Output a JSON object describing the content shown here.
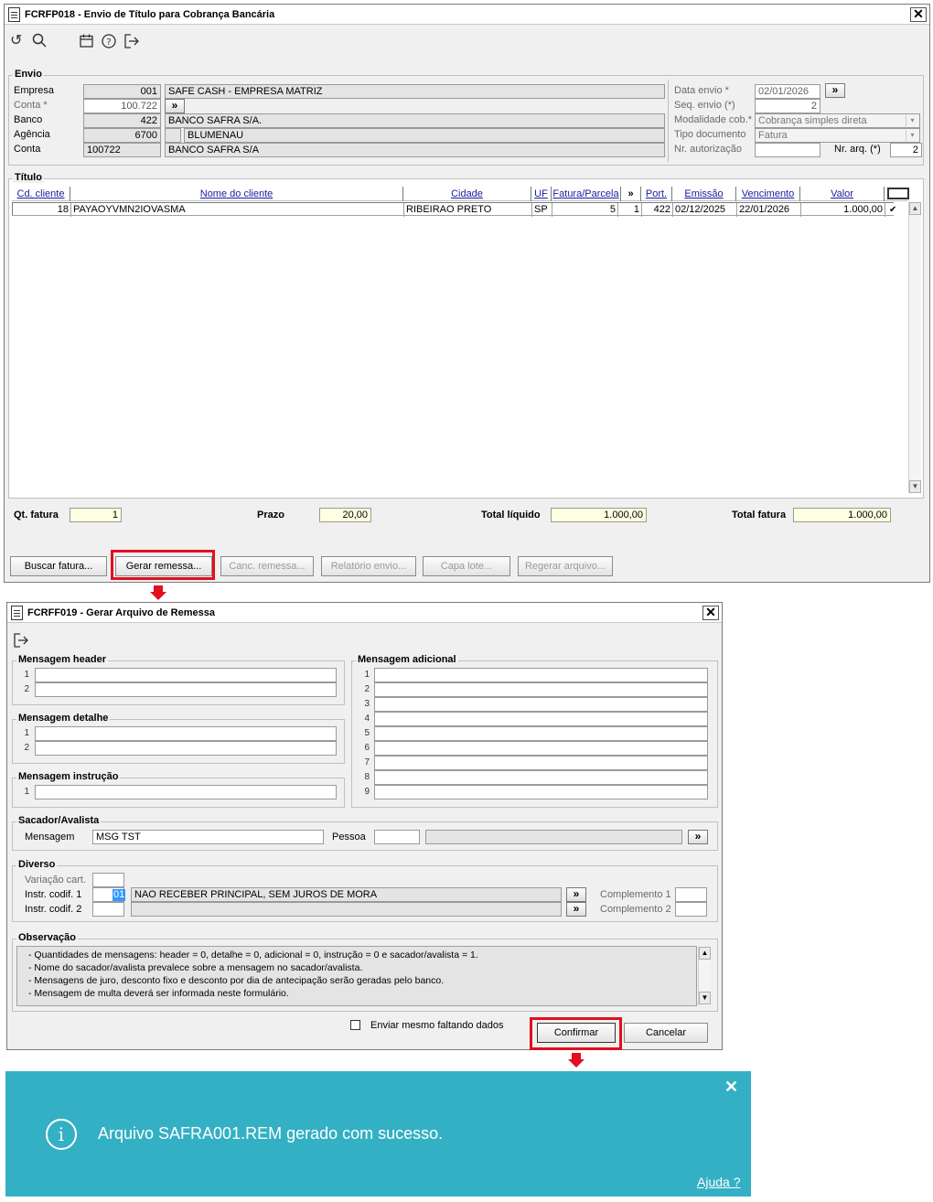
{
  "win1": {
    "title": "FCRFP018 - Envio de Título para Cobrança Bancária",
    "envio": {
      "legend": "Envio",
      "empresa_label": "Empresa",
      "empresa_code": "001",
      "empresa_name": "SAFE CASH - EMPRESA MATRIZ",
      "conta_label": "Conta *",
      "conta_value": "100.722",
      "banco_label": "Banco",
      "banco_code": "422",
      "banco_name": "BANCO SAFRA S/A.",
      "agencia_label": "Agência",
      "agencia_code": "6700",
      "agencia_name": "BLUMENAU",
      "conta2_label": "Conta",
      "conta2_code": "100722",
      "conta2_name": "BANCO SAFRA S/A",
      "data_envio_label": "Data envio *",
      "data_envio_value": "02/01/2026",
      "seq_envio_label": "Seq. envio (*)",
      "seq_envio_value": "2",
      "modalidade_label": "Modalidade cob.*",
      "modalidade_value": "Cobrança simples direta",
      "tipo_doc_label": "Tipo documento",
      "tipo_doc_value": "Fatura",
      "nr_autorizacao_label": "Nr. autorização",
      "nr_autorizacao_value": "",
      "nr_arq_label": "Nr. arq. (*)",
      "nr_arq_value": "2",
      "more_glyph": "»"
    },
    "titulo": {
      "legend": "Título",
      "columns": [
        "Cd. cliente",
        "Nome do cliente",
        "Cidade",
        "UF",
        "Fatura/Parcela",
        "»",
        "Port.",
        "Emissão",
        "Vencimento",
        "Valor"
      ],
      "rows": [
        {
          "cd": "18",
          "nome": "PAYAOYVMN2IOVASMA",
          "cidade": "RIBEIRAO PRETO",
          "uf": "SP",
          "fatura": "5",
          "parcela": "1",
          "port": "422",
          "emissao": "02/12/2025",
          "vencimento": "22/01/2026",
          "valor": "1.000,00",
          "checked": "✔"
        }
      ]
    },
    "totals": {
      "qt_fatura_label": "Qt. fatura",
      "qt_fatura_value": "1",
      "prazo_label": "Prazo",
      "prazo_value": "20,00",
      "total_liquido_label": "Total líquido",
      "total_liquido_value": "1.000,00",
      "total_fatura_label": "Total fatura",
      "total_fatura_value": "1.000,00"
    },
    "buttons": {
      "buscar": "Buscar fatura...",
      "gerar": "Gerar remessa...",
      "canc": "Canc. remessa...",
      "relatorio": "Relatório envio...",
      "capa": "Capa lote...",
      "regerar": "Regerar arquivo..."
    }
  },
  "win2": {
    "title": "FCRFF019 - Gerar Arquivo de Remessa",
    "header_legend": "Mensagem header",
    "detalhe_legend": "Mensagem detalhe",
    "instrucao_legend": "Mensagem instrução",
    "adicional_legend": "Mensagem adicional",
    "line_numbers_2": [
      "1",
      "2"
    ],
    "line_numbers_1": [
      "1"
    ],
    "line_numbers_9": [
      "1",
      "2",
      "3",
      "4",
      "5",
      "6",
      "7",
      "8",
      "9"
    ],
    "sacador": {
      "legend": "Sacador/Avalista",
      "mensagem_label": "Mensagem",
      "mensagem_value": "MSG TST",
      "pessoa_label": "Pessoa",
      "pessoa_value": ""
    },
    "diverso": {
      "legend": "Diverso",
      "variacao_label": "Variação cart.",
      "instr1_label": "Instr. codif. 1",
      "instr1_code": "01",
      "instr1_desc": "NAO RECEBER PRINCIPAL, SEM JUROS DE MORA",
      "instr2_label": "Instr. codif. 2",
      "compl1_label": "Complemento 1",
      "compl2_label": "Complemento 2"
    },
    "observacao": {
      "legend": "Observação",
      "lines": [
        "- Quantidades de mensagens: header = 0, detalhe = 0, adicional = 0, instrução = 0 e sacador/avalista = 1.",
        "- Nome do sacador/avalista prevalece sobre a mensagem no sacador/avalista.",
        "- Mensagens de  juro, desconto fixo e desconto por dia de antecipação serão geradas pelo banco.",
        "- Mensagem de  multa deverá ser informada neste formulário."
      ]
    },
    "enviar_label": "Enviar mesmo faltando dados",
    "confirmar": "Confirmar",
    "cancelar": "Cancelar"
  },
  "toast": {
    "message": "Arquivo SAFRA001.REM gerado com sucesso.",
    "help": "Ajuda ?",
    "close": "✕",
    "info_glyph": "i",
    "bg_color": "#34b0c4"
  },
  "highlight_color": "#e0101e"
}
